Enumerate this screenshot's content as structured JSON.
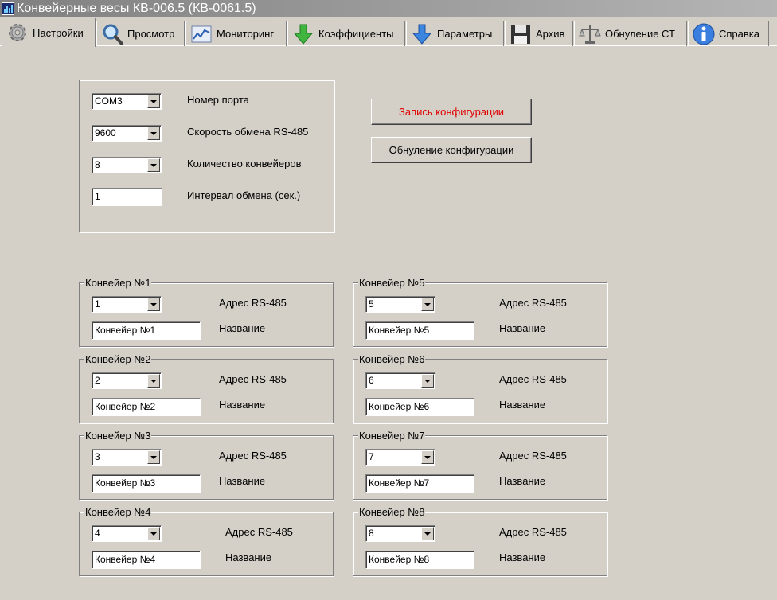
{
  "window": {
    "title": "Конвейерные весы КВ-006.5 (КВ-0061.5)"
  },
  "tabs": [
    {
      "label": "Настройки",
      "icon": "gear-icon"
    },
    {
      "label": "Просмотр",
      "icon": "magnifier-icon"
    },
    {
      "label": "Мониторинг",
      "icon": "chart-icon"
    },
    {
      "label": "Коэффициенты",
      "icon": "green-down-arrow-icon"
    },
    {
      "label": "Параметры",
      "icon": "blue-down-arrow-icon"
    },
    {
      "label": "Архив",
      "icon": "floppy-disk-icon"
    },
    {
      "label": "Обнуление СТ",
      "icon": "scale-icon"
    },
    {
      "label": "Справка",
      "icon": "info-icon"
    }
  ],
  "settings": {
    "port": {
      "value": "COM3",
      "label": "Номер порта"
    },
    "baud": {
      "value": "9600",
      "label": "Скорость обмена RS-485"
    },
    "count": {
      "value": "8",
      "label": "Количество конвейеров"
    },
    "interval": {
      "value": "1",
      "label": "Интервал обмена (сек.)"
    }
  },
  "buttons": {
    "write_config": "Запись конфигурации",
    "reset_config": "Обнуление конфигурации"
  },
  "conveyors": [
    {
      "caption": "Конвейер №1",
      "address": "1",
      "address_label": "Адрес RS-485",
      "name": "Конвейер №1",
      "name_label": "Название"
    },
    {
      "caption": "Конвейер №2",
      "address": "2",
      "address_label": "Адрес RS-485",
      "name": "Конвейер №2",
      "name_label": "Название"
    },
    {
      "caption": "Конвейер №3",
      "address": "3",
      "address_label": "Адрес RS-485",
      "name": "Конвейер №3",
      "name_label": "Название"
    },
    {
      "caption": "Конвейер №4",
      "address": "4",
      "address_label": "Адрес RS-485",
      "name": "Конвейер №4",
      "name_label": "Название"
    },
    {
      "caption": "Конвейер №5",
      "address": "5",
      "address_label": "Адрес RS-485",
      "name": "Конвейер №5",
      "name_label": "Название"
    },
    {
      "caption": "Конвейер №6",
      "address": "6",
      "address_label": "Адрес RS-485",
      "name": "Конвейер №6",
      "name_label": "Название"
    },
    {
      "caption": "Конвейер №7",
      "address": "7",
      "address_label": "Адрес RS-485",
      "name": "Конвейер №7",
      "name_label": "Название"
    },
    {
      "caption": "Конвейер №8",
      "address": "8",
      "address_label": "Адрес RS-485",
      "name": "Конвейер №8",
      "name_label": "Название"
    }
  ],
  "colors": {
    "face": "#d4d0c8",
    "title_gradient_start": "#808080",
    "accent_red": "#e00000"
  }
}
